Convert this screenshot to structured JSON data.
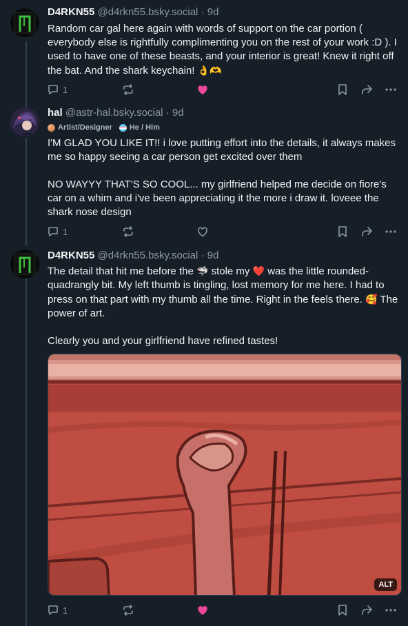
{
  "posts": [
    {
      "author": "D4RKN55",
      "handle": "@d4rkn55.bsky.social",
      "sep": "·",
      "time": "9d",
      "text": "Random car gal here again with words of support on the car portion ( everybody else is rightfully complimenting you on the rest of your work :D ). I used to have one of these beasts, and your interior is great! Knew it right off the bat. And the shark keychain!",
      "text_emoji": "👌🫶",
      "reply_count": "1",
      "liked": true
    },
    {
      "author": "hal",
      "handle": "@astr-hal.bsky.social",
      "sep": "·",
      "time": "9d",
      "badge1": "Artist/Designer",
      "badge2": "He / Him",
      "paragraph1": "I'M GLAD YOU LIKE IT!! i love putting effort into the details, it always makes me so happy seeing a car person get excited over them",
      "paragraph2": "NO WAYYY THAT'S SO COOL... my girlfriend helped me decide on fiore's car on a whim and i've been appreciating it the more i draw it. loveee the shark nose design",
      "reply_count": "1",
      "liked": false
    },
    {
      "author": "D4RKN55",
      "handle": "@d4rkn55.bsky.social",
      "sep": "·",
      "time": "9d",
      "p1_a": "The detail that hit me before the",
      "p1_emoji1": "🦈",
      "p1_b": "stole my",
      "p1_emoji2": "❤️",
      "p1_c": "was the little rounded-quadrangly bit. My left thumb is tingling, lost memory for me here. I had to press on that part with my thumb all the time. Right in the feels there.",
      "p1_emoji3": "🥰",
      "p1_d": "The power of art.",
      "paragraph2": "Clearly you and your girlfriend have refined tastes!",
      "image_alt_badge": "ALT",
      "reply_count": "1",
      "liked": true
    }
  ],
  "colors": {
    "background": "#161e27",
    "like": "#ec4899",
    "muted": "#8b98a5"
  }
}
